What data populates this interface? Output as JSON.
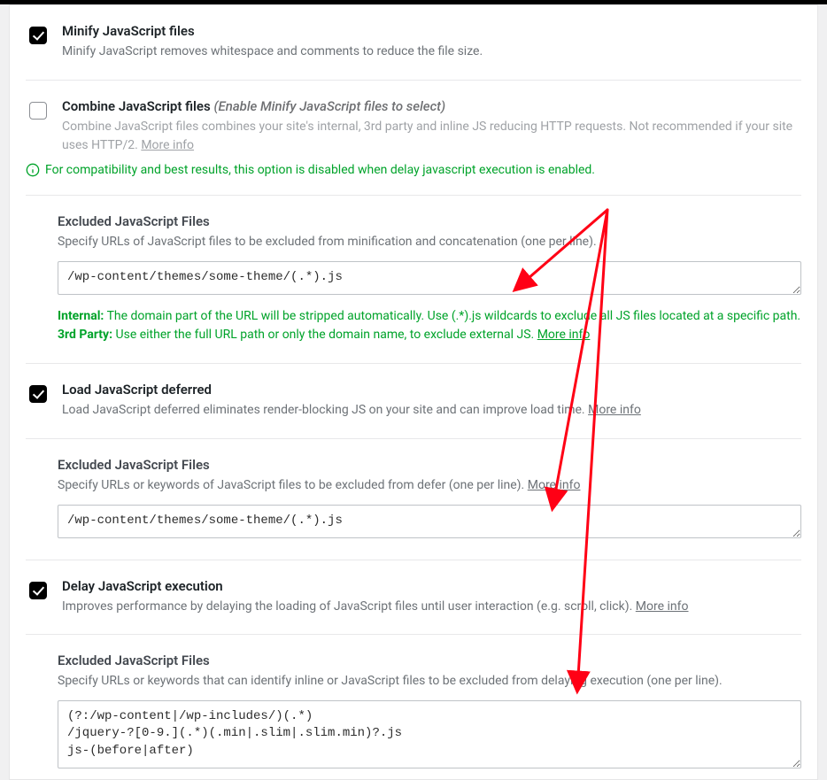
{
  "minify": {
    "checked": true,
    "title": "Minify JavaScript files",
    "desc": "Minify JavaScript removes whitespace and comments to reduce the file size."
  },
  "combine": {
    "checked": false,
    "title": "Combine JavaScript files",
    "hint": "(Enable Minify JavaScript files to select)",
    "desc": "Combine JavaScript files combines your site's internal, 3rd party and inline JS reducing HTTP requests. Not recommended if your site uses HTTP/2.",
    "more_info": "More info",
    "compat_note": "For compatibility and best results, this option is disabled when delay javascript execution is enabled."
  },
  "excluded_minify": {
    "title": "Excluded JavaScript Files",
    "desc": "Specify URLs of JavaScript files to be excluded from minification and concatenation (one per line).",
    "value": "/wp-content/themes/some-theme/(.*).js",
    "internal_label": "Internal:",
    "internal_text": "The domain part of the URL will be stripped automatically. Use (.*).js wildcards to exclude all JS files located at a specific path.",
    "thirdparty_label": "3rd Party:",
    "thirdparty_text": "Use either the full URL path or only the domain name, to exclude external JS.",
    "more_info": "More info"
  },
  "defer": {
    "checked": true,
    "title": "Load JavaScript deferred",
    "desc": "Load JavaScript deferred eliminates render-blocking JS on your site and can improve load time.",
    "more_info": "More info"
  },
  "excluded_defer": {
    "title": "Excluded JavaScript Files",
    "desc_pre": "Specify URLs or keywords of JavaScript files to be excluded from defer (one per line).",
    "more_info": "More info",
    "value": "/wp-content/themes/some-theme/(.*).js"
  },
  "delay": {
    "checked": true,
    "title": "Delay JavaScript execution",
    "desc": "Improves performance by delaying the loading of JavaScript files until user interaction (e.g. scroll, click).",
    "more_info": "More info"
  },
  "excluded_delay": {
    "title": "Excluded JavaScript Files",
    "desc": "Specify URLs or keywords that can identify inline or JavaScript files to be excluded from delaying execution (one per line).",
    "value_lines": [
      "(?:/wp-content|/wp-includes/)(.*)",
      "/jquery-?[0-9.](.*)(.min|.slim|.slim.min)?.js",
      "js-(before|after)"
    ]
  }
}
